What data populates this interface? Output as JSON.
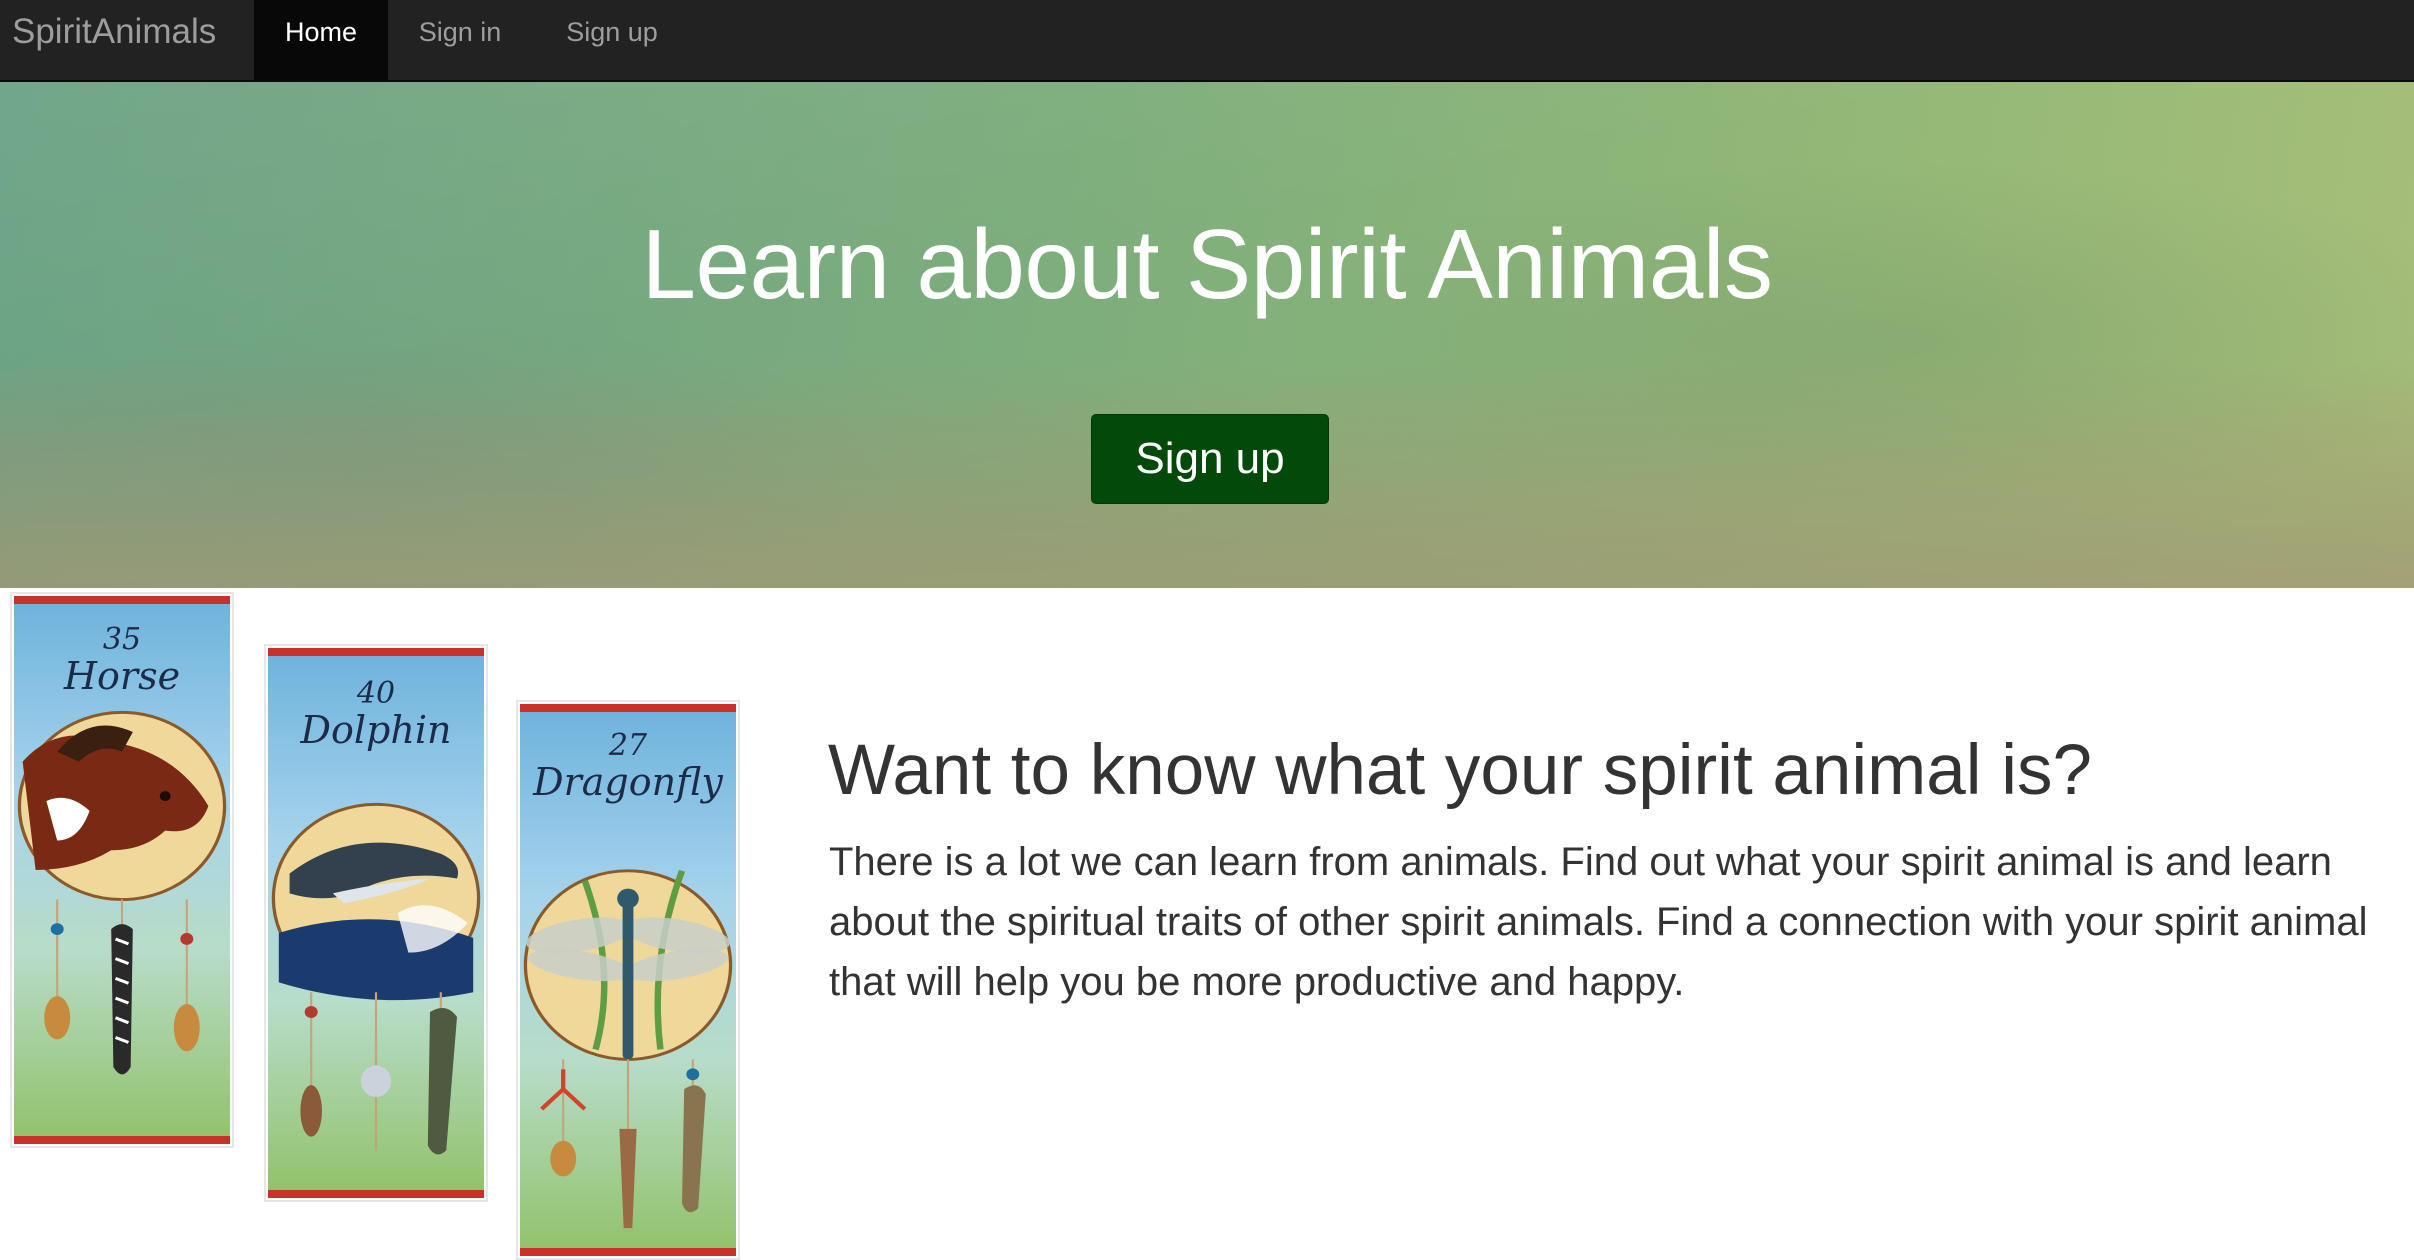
{
  "navbar": {
    "brand": "SpiritAnimals",
    "items": [
      {
        "label": "Home",
        "active": true
      },
      {
        "label": "Sign in",
        "active": false
      },
      {
        "label": "Sign up",
        "active": false
      }
    ]
  },
  "hero": {
    "title": "Learn about Spirit Animals",
    "button_label": "Sign up"
  },
  "cards": [
    {
      "number": "35",
      "name": "Horse"
    },
    {
      "number": "40",
      "name": "Dolphin"
    },
    {
      "number": "27",
      "name": "Dragonfly"
    }
  ],
  "intro": {
    "heading": "Want to know what your spirit animal is?",
    "body": "There is a lot we can learn from animals. Find out what your spirit animal is and learn about the spiritual traits of other spirit animals. Find a connection with your spirit animal that will help you be more productive and happy."
  },
  "colors": {
    "navbar_bg": "#222222",
    "nav_active_bg": "#080808",
    "button_bg": "#034909",
    "card_border_red": "#c9322b",
    "text": "#333333"
  }
}
